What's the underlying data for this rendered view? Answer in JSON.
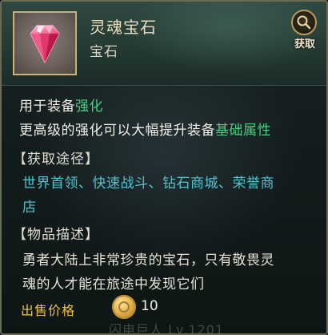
{
  "item": {
    "name": "灵魂宝石",
    "type": "宝石"
  },
  "acquire_button": {
    "label": "获取"
  },
  "description": {
    "line1_prefix": "用于装备",
    "line1_highlight": "强化",
    "line2_prefix": "更高级的强化可以大幅提升装备",
    "line2_highlight": "基础属性"
  },
  "sources": {
    "title": "【获取途径】",
    "line1": "世界首领、快速战斗、钻石商城、荣誉商",
    "line2": "店"
  },
  "lore": {
    "title": "【物品描述】",
    "line1": "勇者大陆上非常珍贵的宝石，只有敬畏灵",
    "line2": "魂的人才能在旅途中发现它们"
  },
  "sell": {
    "label": "出售价格",
    "price": "10"
  },
  "watermark": "闪电巨人 Lv.1201",
  "colors": {
    "highlight_green": "#44d080",
    "source_teal": "#4fc4d0",
    "gold": "#f0c542",
    "gem_pink": "#e8487a"
  },
  "icons": {
    "item": "pink-gem-icon",
    "acquire": "magnifier-icon",
    "currency": "gold-coin-icon"
  }
}
